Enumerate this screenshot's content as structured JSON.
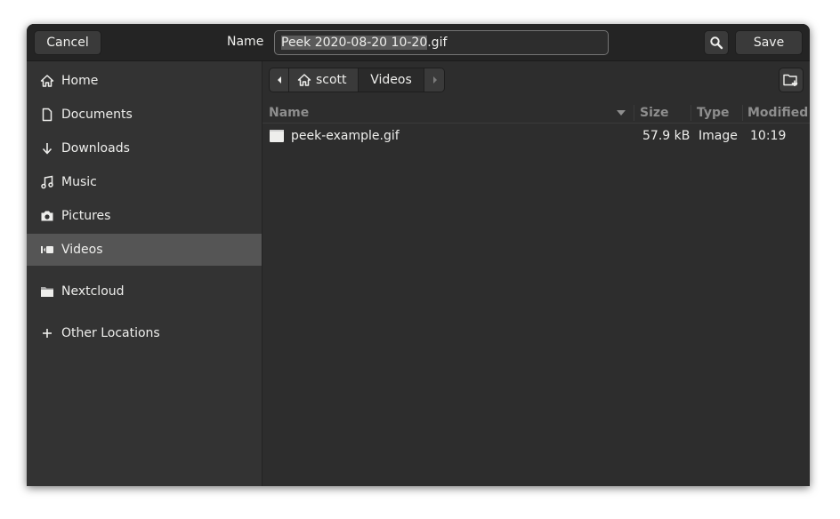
{
  "header": {
    "cancel_label": "Cancel",
    "name_label": "Name",
    "filename_selected": "Peek 2020-08-20 10-20",
    "filename_ext": ".gif",
    "save_label": "Save"
  },
  "sidebar": {
    "items": [
      {
        "label": "Home",
        "icon": "home-icon"
      },
      {
        "label": "Documents",
        "icon": "document-icon"
      },
      {
        "label": "Downloads",
        "icon": "download-icon"
      },
      {
        "label": "Music",
        "icon": "music-icon"
      },
      {
        "label": "Pictures",
        "icon": "camera-icon"
      },
      {
        "label": "Videos",
        "icon": "video-icon",
        "selected": true
      },
      {
        "label": "Nextcloud",
        "icon": "folder-icon"
      },
      {
        "label": "Other Locations",
        "icon": "plus-icon"
      }
    ]
  },
  "pathbar": {
    "home": "scott",
    "current": "Videos"
  },
  "columns": {
    "name": "Name",
    "size": "Size",
    "type": "Type",
    "modified": "Modified"
  },
  "files": [
    {
      "name": "peek-example.gif",
      "size": "57.9 kB",
      "type": "Image",
      "modified": "10:19"
    }
  ],
  "colors": {
    "window_bg": "#2d2d2d",
    "headerbar_bg": "#242424",
    "sidebar_bg": "#333333",
    "selected_bg": "#555555",
    "text": "#eeeeec",
    "header_text": "#8e8e8e"
  }
}
